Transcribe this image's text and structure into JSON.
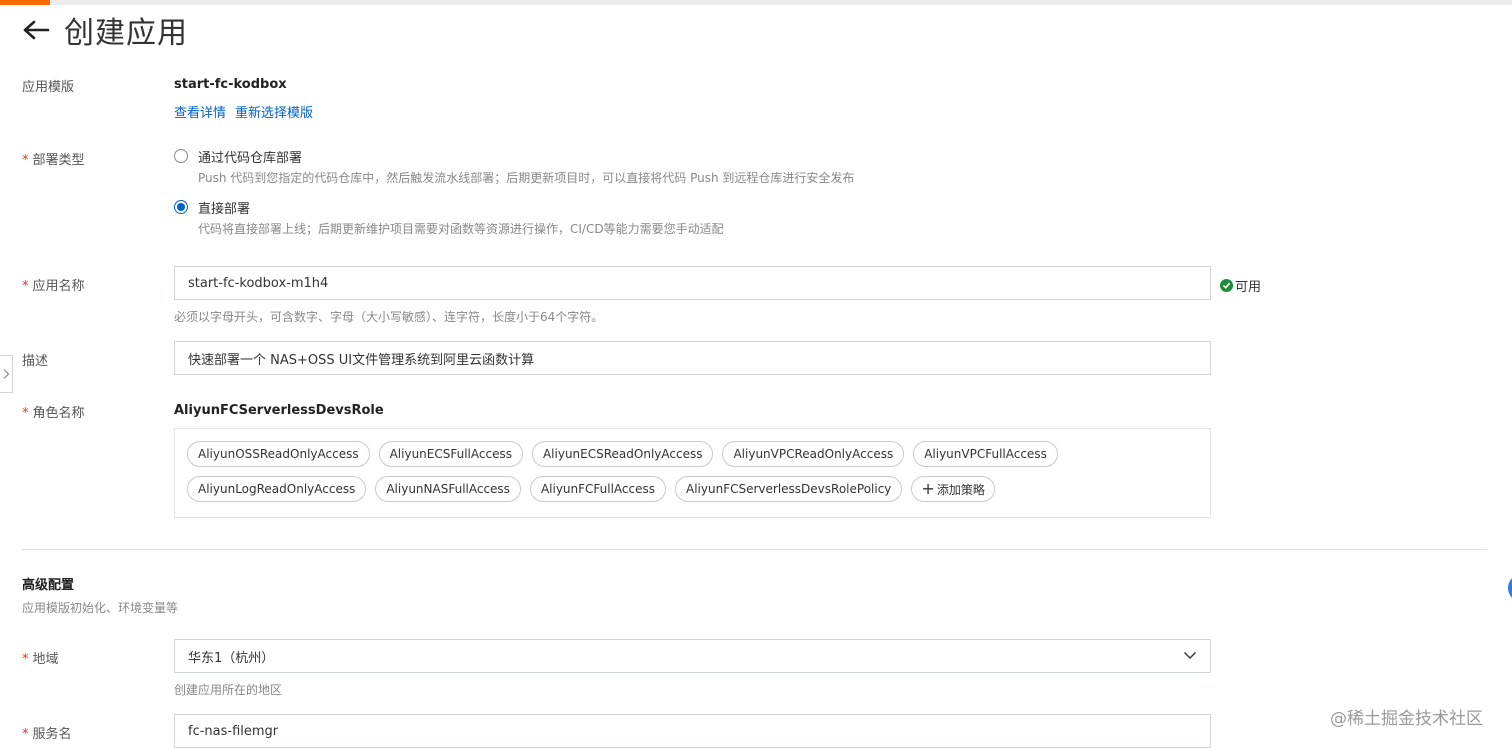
{
  "header": {
    "title": "创建应用"
  },
  "template_row": {
    "label": "应用模版",
    "value": "start-fc-kodbox",
    "links": [
      "查看详情",
      "重新选择模版"
    ]
  },
  "deploy_type": {
    "required": "*",
    "label": "部署类型",
    "options": [
      {
        "label": "通过代码仓库部署",
        "desc": "Push 代码到您指定的代码仓库中，然后触发流水线部署；后期更新项目时，可以直接将代码 Push 到远程仓库进行安全发布",
        "checked": false
      },
      {
        "label": "直接部署",
        "desc": "代码将直接部署上线；后期更新维护项目需要对函数等资源进行操作，CI/CD等能力需要您手动适配",
        "checked": true
      }
    ]
  },
  "app_name": {
    "required": "*",
    "label": "应用名称",
    "value": "start-fc-kodbox-m1h4",
    "status": "可用",
    "hint": "必须以字母开头，可含数字、字母（大小写敏感）、连字符，长度小于64个字符。"
  },
  "description": {
    "label": "描述",
    "value": "快速部署一个 NAS+OSS UI文件管理系统到阿里云函数计算"
  },
  "role": {
    "required": "*",
    "label": "角色名称",
    "value": "AliyunFCServerlessDevsRole",
    "policies": [
      "AliyunOSSReadOnlyAccess",
      "AliyunECSFullAccess",
      "AliyunECSReadOnlyAccess",
      "AliyunVPCReadOnlyAccess",
      "AliyunVPCFullAccess",
      "AliyunLogReadOnlyAccess",
      "AliyunNASFullAccess",
      "AliyunFCFullAccess",
      "AliyunFCServerlessDevsRolePolicy"
    ],
    "add_policy": "添加策略"
  },
  "advanced": {
    "title": "高级配置",
    "subtitle": "应用模版初始化、环境变量等"
  },
  "region": {
    "required": "*",
    "label": "地域",
    "value": "华东1（杭州）",
    "hint": "创建应用所在的地区"
  },
  "service": {
    "required": "*",
    "label": "服务名",
    "value": "fc-nas-filemgr"
  },
  "watermark": "@稀土掘金技术社区",
  "colors": {
    "accent": "#ff6a00",
    "link": "#0064c8",
    "success": "#1e8e3e",
    "required": "#e0301e"
  },
  "icons": [
    "back-arrow-icon",
    "check-circle-icon",
    "plus-icon",
    "chevron-down-icon",
    "chevron-right-icon"
  ]
}
